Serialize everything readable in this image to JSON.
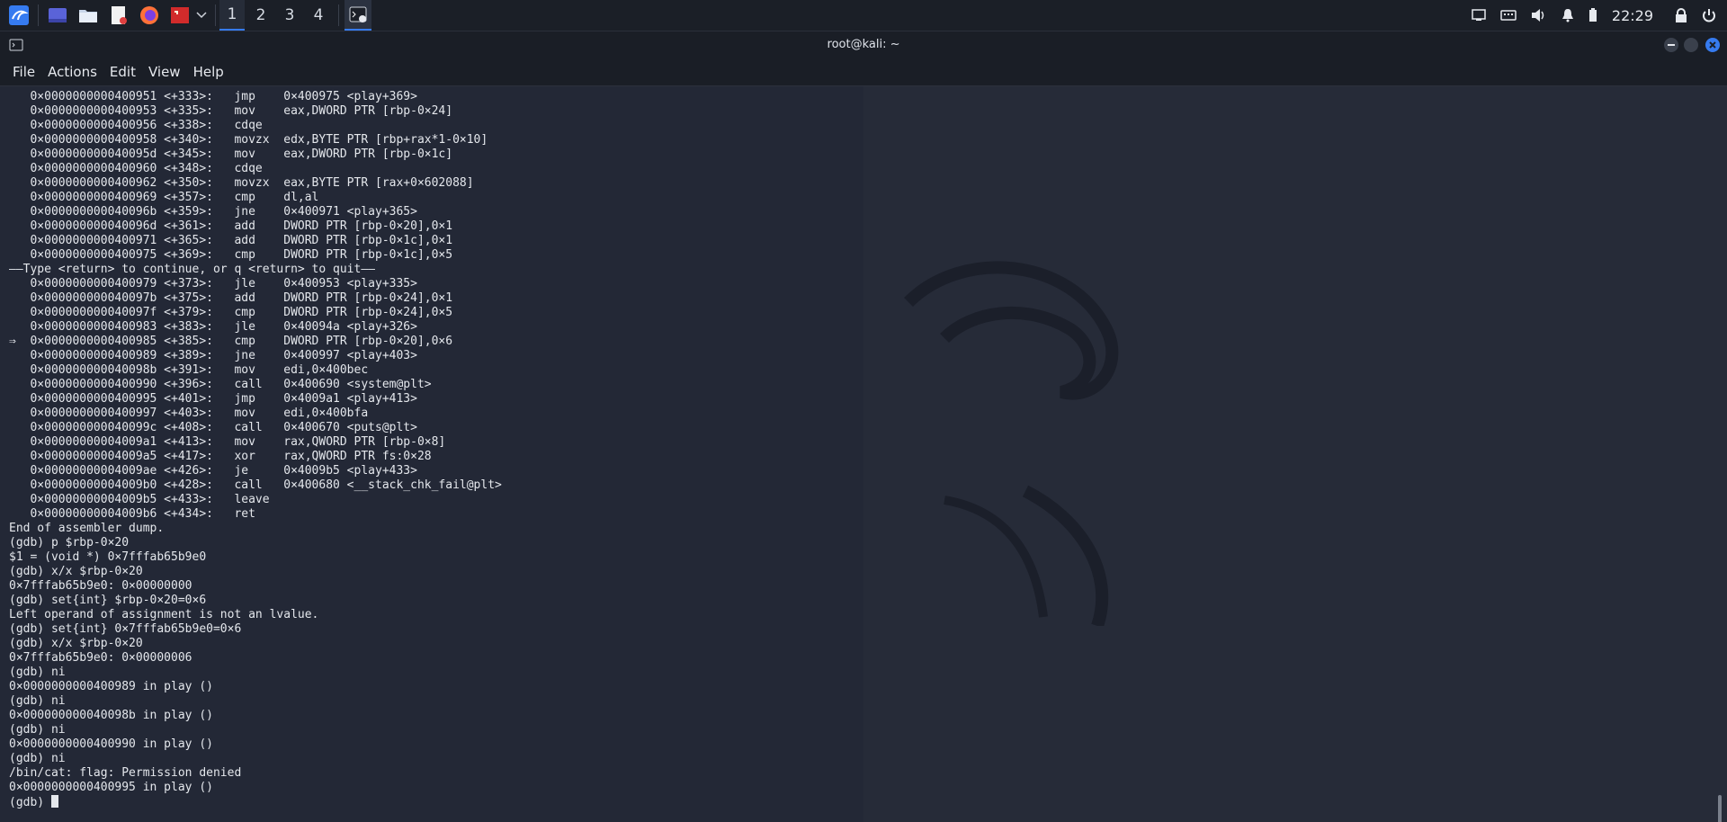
{
  "taskbar": {
    "workspaces": [
      "1",
      "2",
      "3",
      "4"
    ],
    "clock": "22:29"
  },
  "window": {
    "title": "root@kali: ~",
    "menu": [
      "File",
      "Actions",
      "Edit",
      "View",
      "Help"
    ]
  },
  "terminal": {
    "lines": [
      "   0×0000000000400951 <+333>:   jmp    0×400975 <play+369>",
      "   0×0000000000400953 <+335>:   mov    eax,DWORD PTR [rbp-0×24]",
      "   0×0000000000400956 <+338>:   cdqe",
      "   0×0000000000400958 <+340>:   movzx  edx,BYTE PTR [rbp+rax*1-0×10]",
      "   0×000000000040095d <+345>:   mov    eax,DWORD PTR [rbp-0×1c]",
      "   0×0000000000400960 <+348>:   cdqe",
      "   0×0000000000400962 <+350>:   movzx  eax,BYTE PTR [rax+0×602088]",
      "   0×0000000000400969 <+357>:   cmp    dl,al",
      "   0×000000000040096b <+359>:   jne    0×400971 <play+365>",
      "   0×000000000040096d <+361>:   add    DWORD PTR [rbp-0×20],0×1",
      "   0×0000000000400971 <+365>:   add    DWORD PTR [rbp-0×1c],0×1",
      "   0×0000000000400975 <+369>:   cmp    DWORD PTR [rbp-0×1c],0×5",
      "——Type <return> to continue, or q <return> to quit——",
      "   0×0000000000400979 <+373>:   jle    0×400953 <play+335>",
      "   0×000000000040097b <+375>:   add    DWORD PTR [rbp-0×24],0×1",
      "   0×000000000040097f <+379>:   cmp    DWORD PTR [rbp-0×24],0×5",
      "   0×0000000000400983 <+383>:   jle    0×40094a <play+326>",
      "⇒  0×0000000000400985 <+385>:   cmp    DWORD PTR [rbp-0×20],0×6",
      "   0×0000000000400989 <+389>:   jne    0×400997 <play+403>",
      "   0×000000000040098b <+391>:   mov    edi,0×400bec",
      "   0×0000000000400990 <+396>:   call   0×400690 <system@plt>",
      "   0×0000000000400995 <+401>:   jmp    0×4009a1 <play+413>",
      "   0×0000000000400997 <+403>:   mov    edi,0×400bfa",
      "   0×000000000040099c <+408>:   call   0×400670 <puts@plt>",
      "   0×00000000004009a1 <+413>:   mov    rax,QWORD PTR [rbp-0×8]",
      "   0×00000000004009a5 <+417>:   xor    rax,QWORD PTR fs:0×28",
      "   0×00000000004009ae <+426>:   je     0×4009b5 <play+433>",
      "   0×00000000004009b0 <+428>:   call   0×400680 <__stack_chk_fail@plt>",
      "   0×00000000004009b5 <+433>:   leave",
      "   0×00000000004009b6 <+434>:   ret",
      "End of assembler dump.",
      "(gdb) p $rbp-0×20",
      "$1 = (void *) 0×7fffab65b9e0",
      "(gdb) x/x $rbp-0×20",
      "0×7fffab65b9e0: 0×00000000",
      "(gdb) set{int} $rbp-0×20=0×6",
      "Left operand of assignment is not an lvalue.",
      "(gdb) set{int} 0×7fffab65b9e0=0×6",
      "(gdb) x/x $rbp-0×20",
      "0×7fffab65b9e0: 0×00000006",
      "(gdb) ni",
      "0×0000000000400989 in play ()",
      "(gdb) ni",
      "0×000000000040098b in play ()",
      "(gdb) ni",
      "0×0000000000400990 in play ()",
      "(gdb) ni",
      "/bin/cat: flag: Permission denied",
      "0×0000000000400995 in play ()"
    ],
    "prompt": "(gdb) "
  }
}
